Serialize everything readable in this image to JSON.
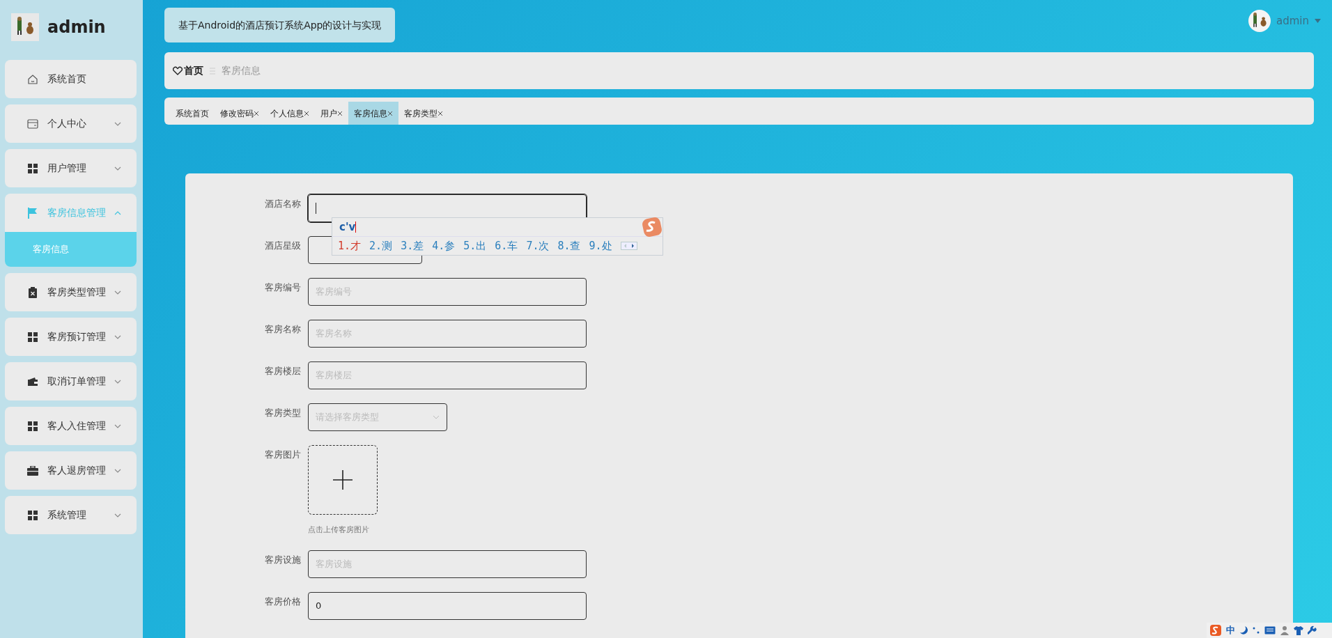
{
  "sidebar": {
    "logo_text": "admin",
    "items": [
      {
        "label": "系统首页",
        "expandable": false,
        "selected": false
      },
      {
        "label": "个人中心",
        "expandable": true,
        "expanded": false,
        "selected": false
      },
      {
        "label": "用户管理",
        "expandable": true,
        "expanded": false,
        "selected": false
      },
      {
        "label": "客房信息管理",
        "expandable": true,
        "expanded": true,
        "selected": true,
        "children": [
          {
            "label": "客房信息",
            "selected": true
          }
        ]
      },
      {
        "label": "客房类型管理",
        "expandable": true,
        "expanded": false,
        "selected": false
      },
      {
        "label": "客房预订管理",
        "expandable": true,
        "expanded": false,
        "selected": false
      },
      {
        "label": "取消订单管理",
        "expandable": true,
        "expanded": false,
        "selected": false
      },
      {
        "label": "客人入住管理",
        "expandable": true,
        "expanded": false,
        "selected": false
      },
      {
        "label": "客人退房管理",
        "expandable": true,
        "expanded": false,
        "selected": false
      },
      {
        "label": "系统管理",
        "expandable": true,
        "expanded": false,
        "selected": false
      }
    ]
  },
  "header": {
    "title": "基于Android的酒店预订系统App的设计与实现",
    "user": "admin"
  },
  "breadcrumb": [
    "首页",
    "客房信息"
  ],
  "tabs": [
    {
      "label": "系统首页",
      "closable": false,
      "selected": false
    },
    {
      "label": "修改密码",
      "closable": true,
      "selected": false
    },
    {
      "label": "个人信息",
      "closable": true,
      "selected": false
    },
    {
      "label": "用户",
      "closable": true,
      "selected": false
    },
    {
      "label": "客房信息",
      "closable": true,
      "selected": true
    },
    {
      "label": "客房类型",
      "closable": true,
      "selected": false
    }
  ],
  "form": {
    "fields": [
      {
        "kind": "input",
        "label": "酒店名称",
        "focused": true
      },
      {
        "kind": "short_input",
        "label": "酒店星级",
        "focused": false
      },
      {
        "kind": "input",
        "label": "客房编号",
        "placeholder": "客房编号",
        "focused": false
      },
      {
        "kind": "input",
        "label": "客房名称",
        "placeholder": "客房名称",
        "focused": false
      },
      {
        "kind": "input",
        "label": "客房楼层",
        "placeholder": "客房楼层",
        "focused": false
      },
      {
        "kind": "select",
        "label": "客房类型",
        "placeholder": "请选择客房类型",
        "focused": false
      },
      {
        "kind": "upload",
        "label": "客房图片",
        "hint": "点击上传客房图片",
        "focused": false
      },
      {
        "kind": "input",
        "label": "客房设施",
        "placeholder": "客房设施",
        "focused": false
      },
      {
        "kind": "input",
        "label": "客房价格",
        "value": "0",
        "focused": false
      }
    ]
  },
  "ime": {
    "composition": "c'v",
    "candidates": [
      {
        "text": "1.才",
        "selected": true
      },
      {
        "text": "2.测",
        "selected": false
      },
      {
        "text": "3.差",
        "selected": false
      },
      {
        "text": "4.参",
        "selected": false
      },
      {
        "text": "5.出",
        "selected": false
      },
      {
        "text": "6.车",
        "selected": false
      },
      {
        "text": "7.次",
        "selected": false
      },
      {
        "text": "8.查",
        "selected": false
      },
      {
        "text": "9.处",
        "selected": false
      }
    ]
  },
  "ime_toolbar": {
    "mode": "中"
  }
}
